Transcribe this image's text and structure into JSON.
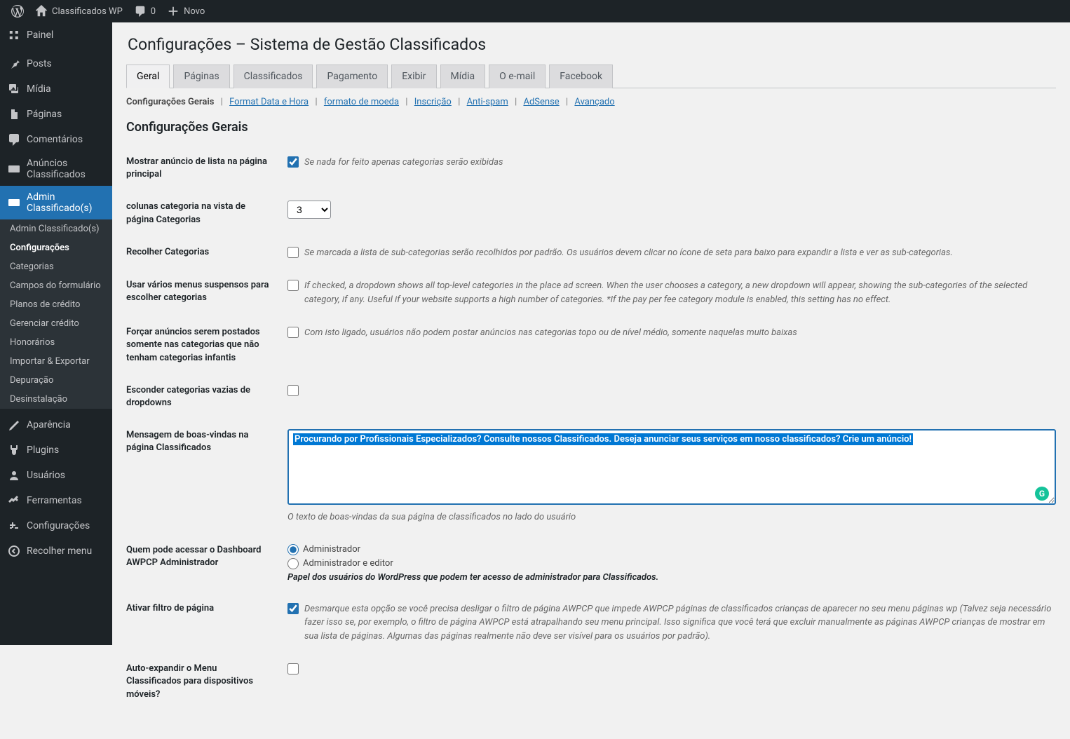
{
  "toolbar": {
    "site_name": "Classificados WP",
    "comments_count": "0",
    "new_label": "Novo"
  },
  "sidebar": {
    "items": [
      {
        "icon": "dashboard",
        "label": "Painel"
      },
      {
        "icon": "pin",
        "label": "Posts"
      },
      {
        "icon": "media",
        "label": "Mídia"
      },
      {
        "icon": "page",
        "label": "Páginas"
      },
      {
        "icon": "comments",
        "label": "Comentários"
      },
      {
        "icon": "card",
        "label": "Anúncios Classificados"
      },
      {
        "icon": "card",
        "label": "Admin Classificado(s)"
      }
    ],
    "submenu": [
      {
        "label": "Admin Classificado(s)"
      },
      {
        "label": "Configurações",
        "active": true
      },
      {
        "label": "Categorias"
      },
      {
        "label": "Campos do formulário"
      },
      {
        "label": "Planos de crédito"
      },
      {
        "label": "Gerenciar crédito"
      },
      {
        "label": "Honorários"
      },
      {
        "label": "Importar & Exportar"
      },
      {
        "label": "Depuração"
      },
      {
        "label": "Desinstalação"
      }
    ],
    "lower_items": [
      {
        "icon": "appearance",
        "label": "Aparência"
      },
      {
        "icon": "plugins",
        "label": "Plugins"
      },
      {
        "icon": "users",
        "label": "Usuários"
      },
      {
        "icon": "tools",
        "label": "Ferramentas"
      },
      {
        "icon": "settings",
        "label": "Configurações"
      },
      {
        "icon": "collapse",
        "label": "Recolher menu"
      }
    ]
  },
  "page": {
    "title": "Configurações – Sistema de Gestão Classificados"
  },
  "tabs": [
    {
      "label": "Geral",
      "active": true
    },
    {
      "label": "Páginas"
    },
    {
      "label": "Classificados"
    },
    {
      "label": "Pagamento"
    },
    {
      "label": "Exibir"
    },
    {
      "label": "Mídia"
    },
    {
      "label": "O e-mail"
    },
    {
      "label": "Facebook"
    }
  ],
  "subsub": {
    "current": "Configurações Gerais",
    "links": [
      "Format Data e Hora",
      "formato de moeda",
      "Inscrição",
      "Anti-spam",
      "AdSense",
      "Avançado"
    ]
  },
  "section_title": "Configurações Gerais",
  "form": {
    "show_ad_list": {
      "label": "Mostrar anúncio de lista na página principal",
      "desc": "Se nada for feito apenas categorias serão exibidas"
    },
    "cat_columns": {
      "label": "colunas categoria na vista de página Categorias",
      "value": "3"
    },
    "collapse_cats": {
      "label": "Recolher Categorias",
      "desc": "Se marcada a lista de sub-categorias serão recolhidos por padrão. Os usuários devem clicar no ícone de seta para baixo para expandir a lista e ver as sub-categorias."
    },
    "multi_dropdowns": {
      "label": "Usar vários menus suspensos para escolher categorias",
      "desc": "If checked, a dropdown shows all top-level categories in the place ad screen. When the user chooses a category, a new dropdown will appear, showing the sub-categories of the selected category, if any. Useful if your website supports a high number of categories. *If the pay per fee category module is enabled, this setting has no effect."
    },
    "force_leaf": {
      "label": "Forçar anúncios serem postados somente nas categorias que não tenham categorias infantis",
      "desc": "Com isto ligado, usuários não podem postar anúncios nas categorias topo ou de nível médio, somente naquelas muito baixas"
    },
    "hide_empty": {
      "label": "Esconder categorias vazias de dropdowns"
    },
    "welcome_msg": {
      "label": "Mensagem de boas-vindas na página Classificados",
      "value": "Procurando por Profissionais Especializados? Consulte nossos Classificados. Deseja anunciar seus serviços em nosso classificados? Crie um anúncio!",
      "desc": "O texto de boas-vindas da sua página de classificados no lado do usuário"
    },
    "dashboard_access": {
      "label": "Quem pode acessar o Dashboard AWPCP Administrador",
      "opt1": "Administrador",
      "opt2": "Administrador e editor",
      "desc": "Papel dos usuários do WordPress que podem ter acesso de administrador para Classificados."
    },
    "page_filter": {
      "label": "Ativar filtro de página",
      "desc": "Desmarque esta opção se você precisa desligar o filtro de página AWPCP que impede AWPCP páginas de classificados crianças de aparecer no seu menu páginas wp (Talvez seja necessário fazer isso se, por exemplo, o filtro de página AWPCP está atrapalhando seu menu principal. Isso significa que você terá que excluir manualmente as páginas AWPCP crianças de mostrar em sua lista de páginas. Algumas das páginas realmente não deve ser visível para os usuários por padrão)."
    },
    "auto_expand": {
      "label": "Auto-expandir o Menu Classificados para dispositivos móveis?"
    }
  }
}
